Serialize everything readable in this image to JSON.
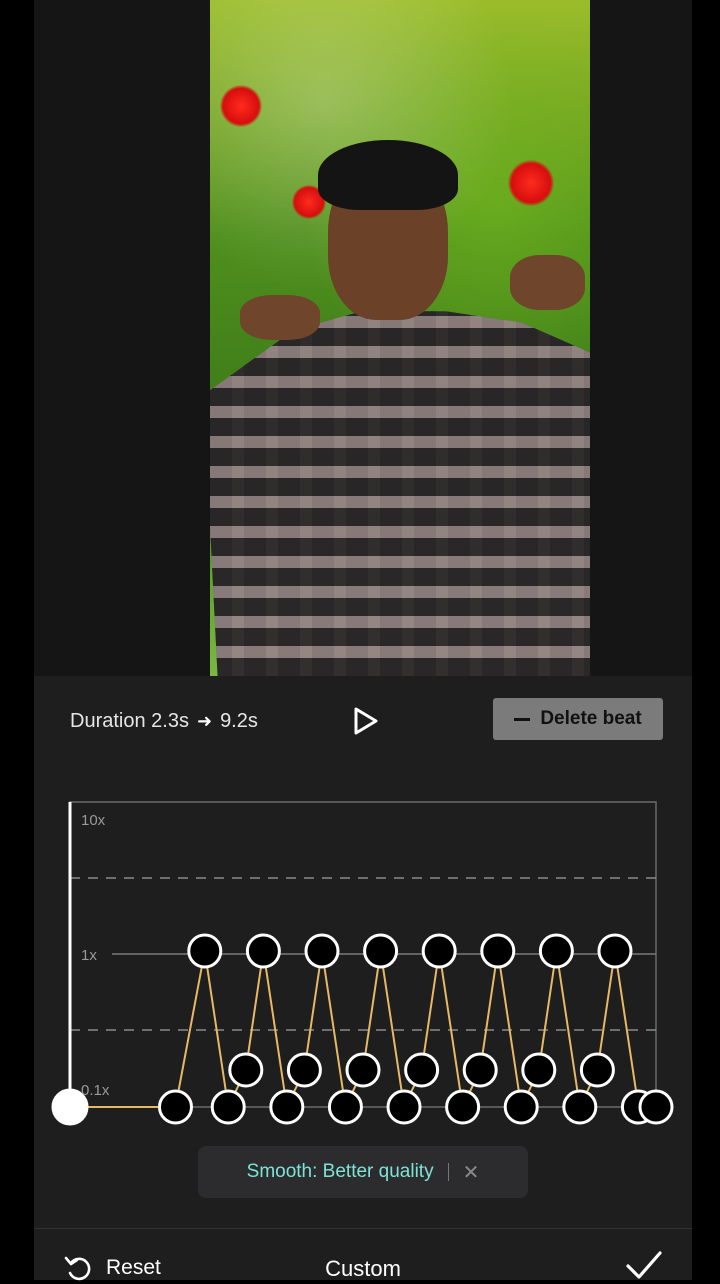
{
  "editor": {
    "duration_label": "Duration 2.3s",
    "duration_arrow": "➜",
    "duration_new": "9.2s",
    "delete_beat_label": "Delete beat",
    "axis_labels": [
      "10x",
      "1x",
      "0.1x"
    ],
    "toast_text": "Smooth: Better quality",
    "toast_close": "✕",
    "reset_label": "Reset",
    "mode_title": "Custom"
  },
  "curve": {
    "line_color": "#e8b864",
    "levels": {
      "top": "10x",
      "mid": "1x",
      "low": "0.1x"
    },
    "points": [
      {
        "t": 0.0,
        "level": "0.1x"
      },
      {
        "t": 0.18,
        "level": "0.1x"
      },
      {
        "t": 0.23,
        "level": "1x"
      },
      {
        "t": 0.27,
        "level": "0.1x"
      },
      {
        "t": 0.3,
        "level": "low-mid"
      },
      {
        "t": 0.33,
        "level": "1x"
      },
      {
        "t": 0.37,
        "level": "0.1x"
      },
      {
        "t": 0.4,
        "level": "low-mid"
      },
      {
        "t": 0.43,
        "level": "1x"
      },
      {
        "t": 0.47,
        "level": "0.1x"
      },
      {
        "t": 0.5,
        "level": "low-mid"
      },
      {
        "t": 0.53,
        "level": "1x"
      },
      {
        "t": 0.57,
        "level": "0.1x"
      },
      {
        "t": 0.6,
        "level": "low-mid"
      },
      {
        "t": 0.63,
        "level": "1x"
      },
      {
        "t": 0.67,
        "level": "0.1x"
      },
      {
        "t": 0.7,
        "level": "low-mid"
      },
      {
        "t": 0.73,
        "level": "1x"
      },
      {
        "t": 0.77,
        "level": "0.1x"
      },
      {
        "t": 0.8,
        "level": "low-mid"
      },
      {
        "t": 0.83,
        "level": "1x"
      },
      {
        "t": 0.87,
        "level": "0.1x"
      },
      {
        "t": 0.9,
        "level": "low-mid"
      },
      {
        "t": 0.93,
        "level": "1x"
      },
      {
        "t": 0.97,
        "level": "0.1x"
      },
      {
        "t": 1.0,
        "level": "0.1x"
      }
    ]
  }
}
